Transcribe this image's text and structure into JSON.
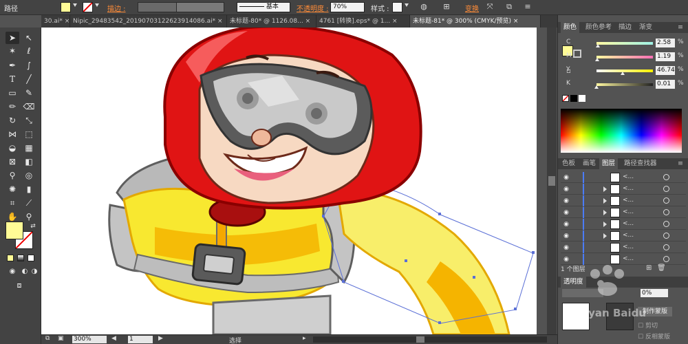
{
  "control_bar": {
    "object_label": "路径",
    "stroke_label": "描边 :",
    "stroke_style_value": "基本",
    "opacity_label": "不透明度 :",
    "opacity_value": "70%",
    "style_label": "样式 :",
    "transform_label": "变换",
    "fill_color": "#fffb96"
  },
  "tabs": [
    {
      "label": "30.ai* ×",
      "active": false
    },
    {
      "label": "Nipic_29483542_20190703122623914086.ai* ×",
      "active": false
    },
    {
      "label": "未标题-80* @ 1126.08...  ×",
      "active": false
    },
    {
      "label": "4761 [转换].eps* @ 1...  ×",
      "active": false
    },
    {
      "label": "未标题-81* @ 300% (CMYK/预览)  ×",
      "active": true
    }
  ],
  "status_bar": {
    "zoom": "300%",
    "page": "1",
    "mode": "选择"
  },
  "color_panel": {
    "tabs": [
      "颜色",
      "颜色参考",
      "描边",
      "渐变"
    ],
    "channels": [
      {
        "name": "C",
        "value": "2.58",
        "unit": "%",
        "level": 0.026,
        "track": "linear-gradient(to right,#fff9a3,#9ff2e6)"
      },
      {
        "name": "M",
        "value": "1.19",
        "unit": "%",
        "level": 0.012,
        "track": "linear-gradient(to right,#fffaa0,#ff6fb5)"
      },
      {
        "name": "Y",
        "value": "46.74",
        "unit": "%",
        "level": 0.467,
        "track": "linear-gradient(to right,#fbfbfb,#fff200)"
      },
      {
        "name": "K",
        "value": "0.01",
        "unit": "%",
        "level": 0.0,
        "track": "linear-gradient(to right,#fff8a0,#222)"
      }
    ]
  },
  "layers_panel": {
    "tabs": [
      "色板",
      "画笔",
      "图层",
      "路径查找器"
    ],
    "row_label": "<...",
    "row_count": 8,
    "footer": "1 个图层"
  },
  "transparency_panel": {
    "title": "透明度",
    "opacity_value": "0%",
    "make_mask_button": "制作蒙版",
    "clip_label": "剪切",
    "invert_mask_label": "反相蒙版"
  },
  "watermark_text": "Jingyan Baidu"
}
